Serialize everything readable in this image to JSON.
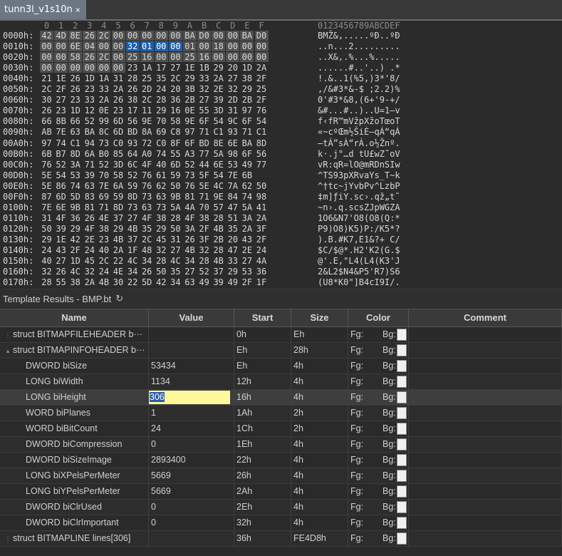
{
  "tab": {
    "title": "tunn3l_v1s10n",
    "close": "×"
  },
  "hex": {
    "col_headers": [
      "0",
      "1",
      "2",
      "3",
      "4",
      "5",
      "6",
      "7",
      "8",
      "9",
      "A",
      "B",
      "C",
      "D",
      "E",
      "F"
    ],
    "ascii_header": "0123456789ABCDEF",
    "rows": [
      {
        "addr": "0000h:",
        "bytes": [
          "42",
          "4D",
          "8E",
          "26",
          "2C",
          "00",
          "00",
          "00",
          "00",
          "00",
          "BA",
          "D0",
          "00",
          "00",
          "BA",
          "D0"
        ],
        "ascii": "BMŽ&,.....ºÐ..ºÐ"
      },
      {
        "addr": "0010h:",
        "bytes": [
          "00",
          "00",
          "6E",
          "04",
          "00",
          "00",
          "32",
          "01",
          "00",
          "00",
          "01",
          "00",
          "18",
          "00",
          "00",
          "00"
        ],
        "ascii": "..n...2........."
      },
      {
        "addr": "0020h:",
        "bytes": [
          "00",
          "00",
          "58",
          "26",
          "2C",
          "00",
          "25",
          "16",
          "00",
          "00",
          "25",
          "16",
          "00",
          "00",
          "00",
          "00"
        ],
        "ascii": "..X&,.%...%....."
      },
      {
        "addr": "0030h:",
        "bytes": [
          "00",
          "00",
          "00",
          "00",
          "00",
          "00",
          "23",
          "1A",
          "17",
          "27",
          "1E",
          "1B",
          "29",
          "20",
          "1D",
          "2A"
        ],
        "ascii": "......#..'..) .*"
      },
      {
        "addr": "0040h:",
        "bytes": [
          "21",
          "1E",
          "26",
          "1D",
          "1A",
          "31",
          "28",
          "25",
          "35",
          "2C",
          "29",
          "33",
          "2A",
          "27",
          "38",
          "2F"
        ],
        "ascii": "!.&..1(%5,)3*'8/"
      },
      {
        "addr": "0050h:",
        "bytes": [
          "2C",
          "2F",
          "26",
          "23",
          "33",
          "2A",
          "26",
          "2D",
          "24",
          "20",
          "3B",
          "32",
          "2E",
          "32",
          "29",
          "25"
        ],
        "ascii": ",/&#3*&-$ ;2.2)%"
      },
      {
        "addr": "0060h:",
        "bytes": [
          "30",
          "27",
          "23",
          "33",
          "2A",
          "26",
          "38",
          "2C",
          "28",
          "36",
          "2B",
          "27",
          "39",
          "2D",
          "2B",
          "2F"
        ],
        "ascii": "0'#3*&8,(6+'9-+/"
      },
      {
        "addr": "0070h:",
        "bytes": [
          "26",
          "23",
          "1D",
          "12",
          "0E",
          "23",
          "17",
          "11",
          "29",
          "16",
          "0E",
          "55",
          "3D",
          "31",
          "97",
          "76"
        ],
        "ascii": "&#...#..)..U=1—v"
      },
      {
        "addr": "0080h:",
        "bytes": [
          "66",
          "8B",
          "66",
          "52",
          "99",
          "6D",
          "56",
          "9E",
          "70",
          "58",
          "9E",
          "6F",
          "54",
          "9C",
          "6F",
          "54"
        ],
        "ascii": "f‹fR™mVžpXžoTœoT"
      },
      {
        "addr": "0090h:",
        "bytes": [
          "AB",
          "7E",
          "63",
          "BA",
          "8C",
          "6D",
          "BD",
          "8A",
          "69",
          "C8",
          "97",
          "71",
          "C1",
          "93",
          "71",
          "C1"
        ],
        "ascii": "«~cºŒm½ŠiÈ—qÁ“qÁ"
      },
      {
        "addr": "00A0h:",
        "bytes": [
          "97",
          "74",
          "C1",
          "94",
          "73",
          "C0",
          "93",
          "72",
          "C0",
          "8F",
          "6F",
          "BD",
          "8E",
          "6E",
          "BA",
          "8D"
        ],
        "ascii": "—tÁ”sÀ“rÀ.o½Žnº."
      },
      {
        "addr": "00B0h:",
        "bytes": [
          "6B",
          "B7",
          "8D",
          "6A",
          "B0",
          "85",
          "64",
          "A0",
          "74",
          "55",
          "A3",
          "77",
          "5A",
          "98",
          "6F",
          "56"
        ],
        "ascii": "k·.j°…d tU£wZ˜oV"
      },
      {
        "addr": "00C0h:",
        "bytes": [
          "76",
          "52",
          "3A",
          "71",
          "52",
          "3D",
          "6C",
          "4F",
          "40",
          "6D",
          "52",
          "44",
          "6E",
          "53",
          "49",
          "77"
        ],
        "ascii": "vR:qR=lO@mRDnSIw"
      },
      {
        "addr": "00D0h:",
        "bytes": [
          "5E",
          "54",
          "53",
          "39",
          "70",
          "58",
          "52",
          "76",
          "61",
          "59",
          "73",
          "5F",
          "54",
          "7E",
          "6B"
        ],
        "ascii": "^TS93pXRvaYs_T~k"
      },
      {
        "addr": "00E0h:",
        "bytes": [
          "5E",
          "86",
          "74",
          "63",
          "7E",
          "6A",
          "59",
          "76",
          "62",
          "50",
          "76",
          "5E",
          "4C",
          "7A",
          "62",
          "50"
        ],
        "ascii": "^†tc~jYvbPv^LzbP"
      },
      {
        "addr": "00F0h:",
        "bytes": [
          "87",
          "6D",
          "5D",
          "83",
          "69",
          "59",
          "8D",
          "73",
          "63",
          "9B",
          "81",
          "71",
          "9E",
          "84",
          "74",
          "98"
        ],
        "ascii": "‡m]ƒiY.sc›.qž„t˜"
      },
      {
        "addr": "0100h:",
        "bytes": [
          "7E",
          "6E",
          "9B",
          "81",
          "71",
          "8D",
          "73",
          "63",
          "73",
          "5A",
          "4A",
          "70",
          "57",
          "47",
          "5A",
          "41"
        ],
        "ascii": "~n›.q.scsZJpWGZA"
      },
      {
        "addr": "0110h:",
        "bytes": [
          "31",
          "4F",
          "36",
          "26",
          "4E",
          "37",
          "27",
          "4F",
          "38",
          "28",
          "4F",
          "38",
          "28",
          "51",
          "3A",
          "2A"
        ],
        "ascii": "1O6&N7'O8(O8(Q:*"
      },
      {
        "addr": "0120h:",
        "bytes": [
          "50",
          "39",
          "29",
          "4F",
          "38",
          "29",
          "4B",
          "35",
          "29",
          "50",
          "3A",
          "2F",
          "4B",
          "35",
          "2A",
          "3F"
        ],
        "ascii": "P9)O8)K5)P:/K5*?"
      },
      {
        "addr": "0130h:",
        "bytes": [
          "29",
          "1E",
          "42",
          "2E",
          "23",
          "4B",
          "37",
          "2C",
          "45",
          "31",
          "26",
          "3F",
          "2B",
          "20",
          "43",
          "2F"
        ],
        "ascii": ").B.#K7,E1&?+ C/"
      },
      {
        "addr": "0140h:",
        "bytes": [
          "24",
          "43",
          "2F",
          "24",
          "40",
          "2A",
          "1F",
          "48",
          "32",
          "27",
          "4B",
          "32",
          "28",
          "47",
          "2E",
          "24"
        ],
        "ascii": "$C/$@*.H2'K2(G.$"
      },
      {
        "addr": "0150h:",
        "bytes": [
          "40",
          "27",
          "1D",
          "45",
          "2C",
          "22",
          "4C",
          "34",
          "28",
          "4C",
          "34",
          "28",
          "4B",
          "33",
          "27",
          "4A"
        ],
        "ascii": "@'.E,\"L4(L4(K3'J"
      },
      {
        "addr": "0160h:",
        "bytes": [
          "32",
          "26",
          "4C",
          "32",
          "24",
          "4E",
          "34",
          "26",
          "50",
          "35",
          "27",
          "52",
          "37",
          "29",
          "53",
          "36"
        ],
        "ascii": "2&L2$N4&P5'R7)S6"
      },
      {
        "addr": "0170h:",
        "bytes": [
          "28",
          "55",
          "38",
          "2A",
          "4B",
          "30",
          "22",
          "5D",
          "42",
          "34",
          "63",
          "49",
          "39",
          "49",
          "2F",
          "1F"
        ],
        "ascii": "(U8*K0\"]B4cI9I/."
      }
    ]
  },
  "template": {
    "title": "Template Results - BMP.bt",
    "refresh_icon": "↻",
    "columns": {
      "name": "Name",
      "value": "Value",
      "start": "Start",
      "size": "Size",
      "color": "Color",
      "comment": "Comment"
    },
    "rows": [
      {
        "name": "struct BITMAPFILEHEADER b···",
        "value": "",
        "start": "0h",
        "size": "Eh",
        "fg": "Fg:",
        "bg": "Bg:",
        "level": 1,
        "expander": "⋮"
      },
      {
        "name": "struct BITMAPINFOHEADER b···",
        "value": "",
        "start": "Eh",
        "size": "28h",
        "fg": "Fg:",
        "bg": "Bg:",
        "level": 1,
        "expander": "▴"
      },
      {
        "name": "DWORD biSize",
        "value": "53434",
        "start": "Eh",
        "size": "4h",
        "fg": "Fg:",
        "bg": "Bg:",
        "level": 2
      },
      {
        "name": "LONG biWidth",
        "value": "1134",
        "start": "12h",
        "size": "4h",
        "fg": "Fg:",
        "bg": "Bg:",
        "level": 2
      },
      {
        "name": "LONG biHeight",
        "value": "306",
        "start": "16h",
        "size": "4h",
        "fg": "Fg:",
        "bg": "Bg:",
        "level": 2,
        "editing": true
      },
      {
        "name": "WORD biPlanes",
        "value": "1",
        "start": "1Ah",
        "size": "2h",
        "fg": "Fg:",
        "bg": "Bg:",
        "level": 2
      },
      {
        "name": "WORD biBitCount",
        "value": "24",
        "start": "1Ch",
        "size": "2h",
        "fg": "Fg:",
        "bg": "Bg:",
        "level": 2
      },
      {
        "name": "DWORD biCompression",
        "value": "0",
        "start": "1Eh",
        "size": "4h",
        "fg": "Fg:",
        "bg": "Bg:",
        "level": 2
      },
      {
        "name": "DWORD biSizeImage",
        "value": "2893400",
        "start": "22h",
        "size": "4h",
        "fg": "Fg:",
        "bg": "Bg:",
        "level": 2
      },
      {
        "name": "LONG biXPelsPerMeter",
        "value": "5669",
        "start": "26h",
        "size": "4h",
        "fg": "Fg:",
        "bg": "Bg:",
        "level": 2
      },
      {
        "name": "LONG biYPelsPerMeter",
        "value": "5669",
        "start": "2Ah",
        "size": "4h",
        "fg": "Fg:",
        "bg": "Bg:",
        "level": 2
      },
      {
        "name": "DWORD biClrUsed",
        "value": "0",
        "start": "2Eh",
        "size": "4h",
        "fg": "Fg:",
        "bg": "Bg:",
        "level": 2
      },
      {
        "name": "DWORD biClrImportant",
        "value": "0",
        "start": "32h",
        "size": "4h",
        "fg": "Fg:",
        "bg": "Bg:",
        "level": 2
      },
      {
        "name": "struct BITMAPLINE lines[306]",
        "value": "",
        "start": "36h",
        "size": "FE4D8h",
        "fg": "Fg:",
        "bg": "Bg:",
        "level": 1,
        "expander": "⋮"
      }
    ]
  },
  "colors": {
    "selection": "#1e5ea8",
    "edit_bg": "#fdf99a",
    "tab_bg": "#6d7783",
    "header_bytes_bg": "#505050"
  }
}
